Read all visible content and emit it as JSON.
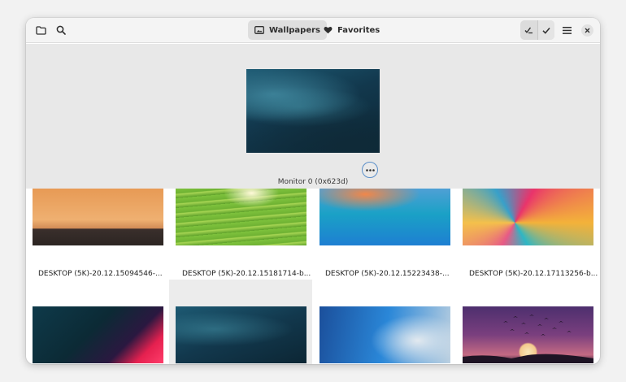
{
  "header": {
    "view_tabs": [
      {
        "label": "Wallpapers",
        "icon": "image-icon",
        "active": true
      },
      {
        "label": "Favorites",
        "icon": "heart-icon",
        "active": false
      }
    ]
  },
  "preview": {
    "monitor_label": "Monitor 0 (0x623d)",
    "more_icon": "ellipsis-icon"
  },
  "wallpapers": [
    {
      "caption": "DESKTOP (5K)-20.12.15094546-..."
    },
    {
      "caption": "DESKTOP (5K)-20.12.15181714-b..."
    },
    {
      "caption": "DESKTOP (5K)-20.12.15223438-..."
    },
    {
      "caption": "DESKTOP (5K)-20.12.17113256-b..."
    },
    {
      "caption": ""
    },
    {
      "caption": ""
    },
    {
      "caption": ""
    },
    {
      "caption": ""
    }
  ],
  "colors": {
    "accent": "#5b8fc9",
    "headerbar": "#f4f4f4",
    "preview_bg": "#e8e8e8"
  }
}
